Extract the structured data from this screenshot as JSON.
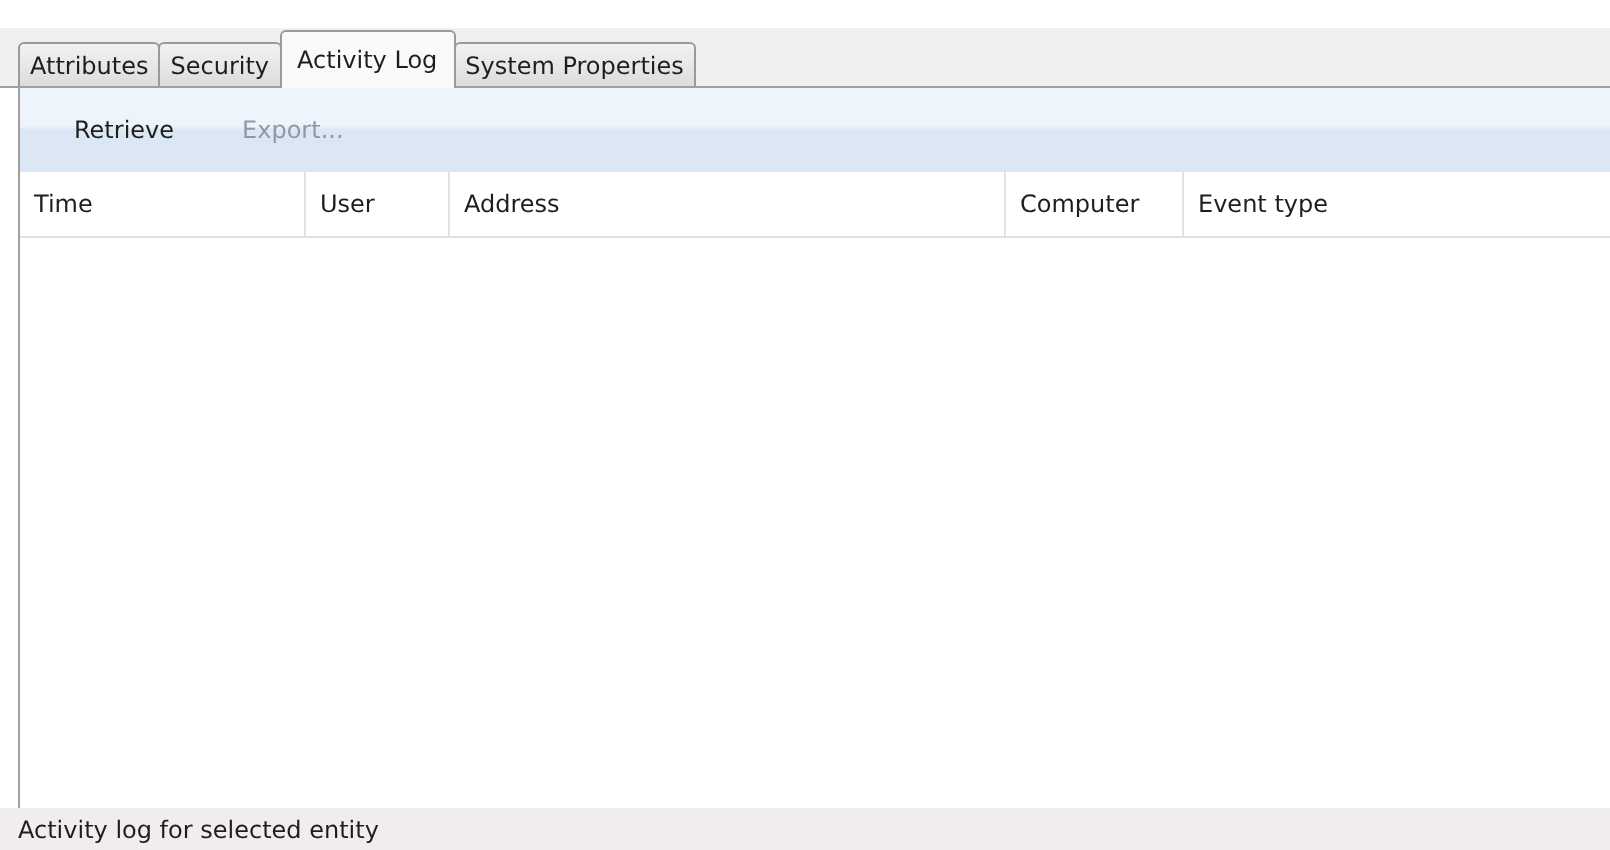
{
  "tabs": [
    {
      "label": "Attributes",
      "selected": false
    },
    {
      "label": "Security",
      "selected": false
    },
    {
      "label": "Activity Log",
      "selected": true
    },
    {
      "label": "System Properties",
      "selected": false
    }
  ],
  "toolbar": [
    {
      "label": "Retrieve",
      "disabled": false
    },
    {
      "label": "Export...",
      "disabled": true
    }
  ],
  "table": {
    "columns": [
      "Time",
      "User",
      "Address",
      "Computer",
      "Event type"
    ]
  },
  "status_bar": "Activity log for selected entity"
}
